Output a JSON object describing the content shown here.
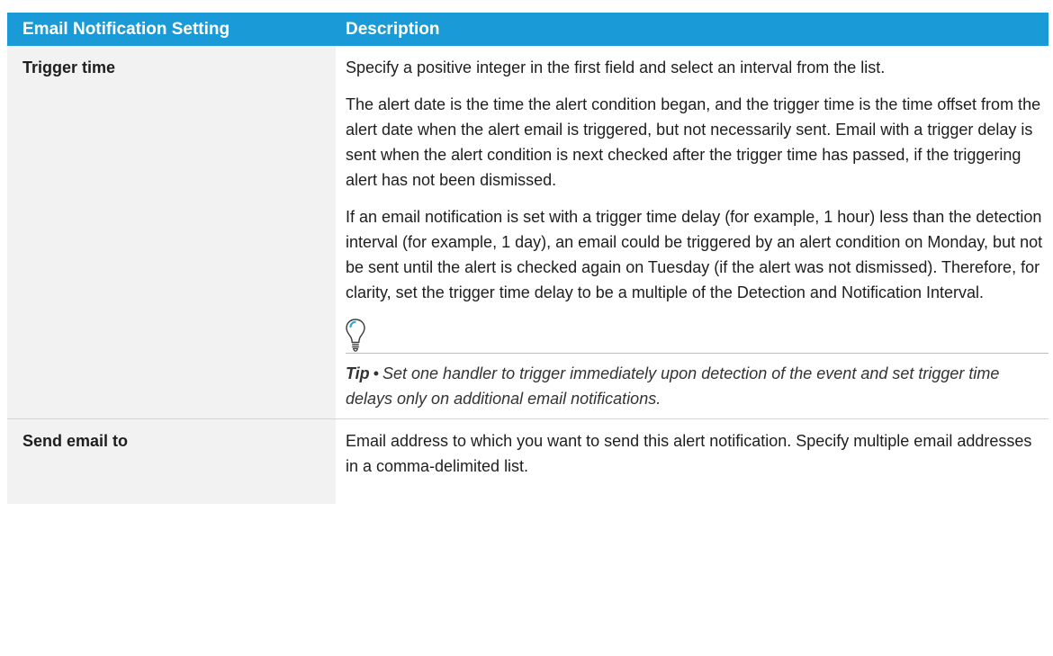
{
  "table": {
    "headers": {
      "setting": "Email Notification Setting",
      "description": "Description"
    },
    "rows": [
      {
        "setting": "Trigger time",
        "paragraphs": [
          "Specify a positive integer in the first field and select an interval from the list.",
          "The alert date is the time the alert condition began, and the trigger time is the time offset from the alert date when the alert email is triggered, but not necessarily sent. Email with a trigger delay is sent when the alert condition is next checked after the trigger time has passed, if the triggering alert has not been dismissed.",
          "If an email notification is set with a trigger time delay (for example, 1 hour) less than the detection interval (for example, 1 day), an email could be triggered by an alert condition on Monday, but not be sent until the alert is checked again on Tuesday (if the alert was not dismissed). Therefore, for clarity, set the trigger time delay to be a multiple of the Detection and Notification Interval."
        ],
        "tip": {
          "icon": "lightbulb-icon",
          "label": "Tip",
          "separator": "•",
          "text": "Set one handler to trigger immediately upon detection of the event and set trigger time delays only on additional email notifications."
        }
      },
      {
        "setting": "Send email to",
        "paragraphs": [
          "Email address to which you want to send this alert notification. Specify multiple email addresses in a comma-delimited list."
        ]
      }
    ]
  },
  "colors": {
    "header_bg": "#1a9bd7",
    "header_text": "#ffffff",
    "setting_col_bg": "#f2f2f2",
    "tip_icon_accent": "#29a8e0"
  }
}
